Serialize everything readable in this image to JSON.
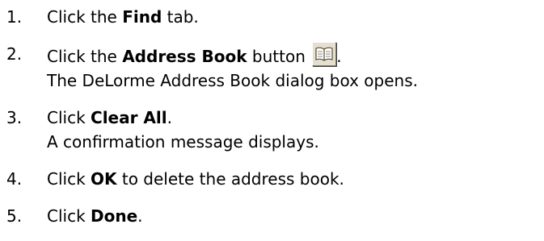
{
  "steps": [
    {
      "number": "1.",
      "before": "Click the ",
      "bold": "Find",
      "after": " tab."
    },
    {
      "number": "2.",
      "before": "Click the ",
      "bold": "Address Book",
      "after": " button",
      "icon": "address-book-icon",
      "after_icon": ".",
      "line2": "The DeLorme Address Book dialog box opens."
    },
    {
      "number": "3.",
      "before": "Click ",
      "bold": "Clear All",
      "after": ".",
      "line2": "A confirmation message displays."
    },
    {
      "number": "4.",
      "before": "Click ",
      "bold": "OK",
      "after": " to delete the address book."
    },
    {
      "number": "5.",
      "before": "Click ",
      "bold": "Done",
      "after": "."
    }
  ]
}
